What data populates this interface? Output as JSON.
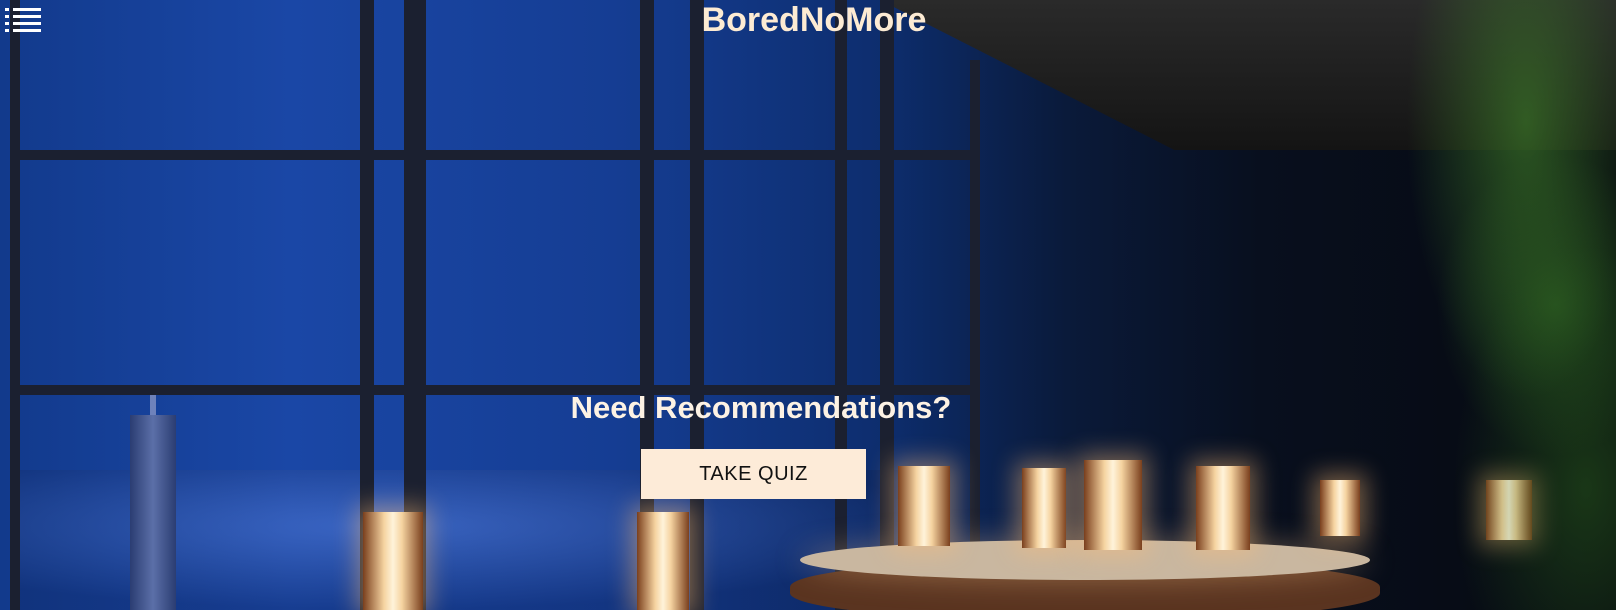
{
  "header": {
    "brand": "BoredNoMore",
    "menu_icon": "list-icon"
  },
  "hero": {
    "headline": "Need Recommendations?",
    "cta_label": "TAKE QUIZ"
  },
  "colors": {
    "brand_text": "#fdebd3",
    "cta_background": "#fdebd8",
    "cta_text": "#111111"
  }
}
